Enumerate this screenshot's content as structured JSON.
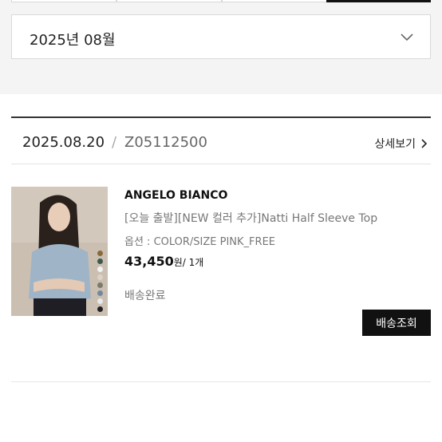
{
  "filter": {
    "selected_month": "2025년 08월"
  },
  "order": {
    "date": "2025.08.20",
    "separator": "/",
    "number": "Z05112500",
    "detail_link": "상세보기",
    "item": {
      "brand": "ANGELO BIANCO",
      "name": "[오늘 출발][NEW 컬러 추가]Natti Half Sleeve Top",
      "option": "옵션 : COLOR/SIZE PINK_FREE",
      "price": "43,450",
      "unit_qty": "원/ 1개",
      "status": "배송완료",
      "track_button": "배송조회",
      "swatch_colors": [
        "#8a6a3a",
        "#3b5a4a",
        "#f2f2f2",
        "#dcd3c5",
        "#7b7b6b",
        "#6f8aa0",
        "#e9e9e9",
        "#222222"
      ]
    }
  },
  "icons": {
    "chevron_down": "chevron-down-icon",
    "chevron_right": "chevron-right-icon"
  }
}
